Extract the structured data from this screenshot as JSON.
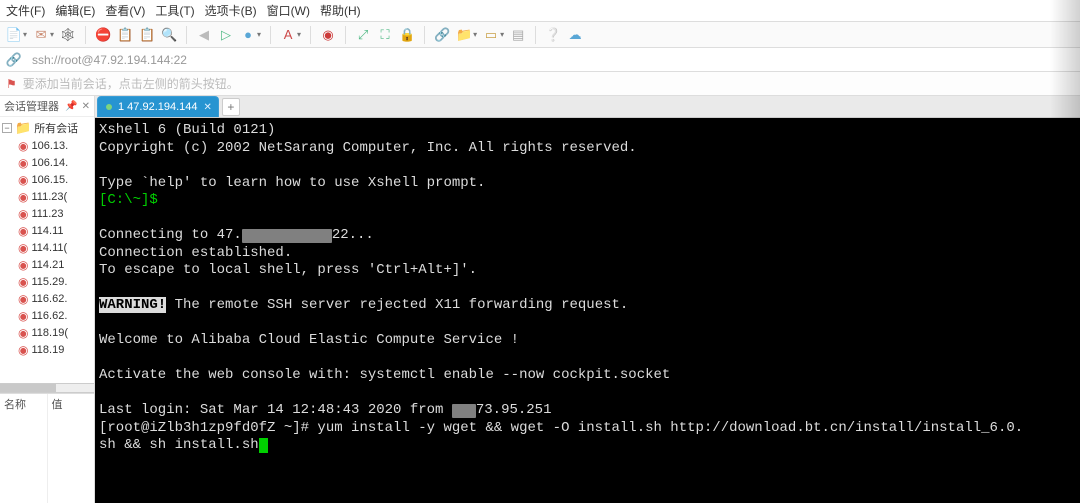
{
  "menu": {
    "items": [
      "文件(F)",
      "编辑(E)",
      "查看(V)",
      "工具(T)",
      "选项卡(B)",
      "窗口(W)",
      "帮助(H)"
    ]
  },
  "toolbar": {
    "icons": [
      {
        "name": "new-session-icon",
        "glyph": "📄",
        "drop": true,
        "clr": "#3a77c2"
      },
      {
        "name": "open-icon",
        "glyph": "✉",
        "drop": true,
        "clr": "#c9886e"
      },
      {
        "name": "reconnect-icon",
        "glyph": "🕸",
        "clr": "#555"
      },
      {
        "name": "disconnect-icon",
        "glyph": "⛔",
        "clr": "#aaa",
        "sep_before": true
      },
      {
        "name": "copy-icon",
        "glyph": "📋",
        "clr": "#3a77c2"
      },
      {
        "name": "paste-icon",
        "glyph": "📋",
        "clr": "#aaa"
      },
      {
        "name": "find-icon",
        "glyph": "🔍",
        "clr": "#555"
      },
      {
        "name": "nav-back-icon",
        "glyph": "◀",
        "clr": "#bbb",
        "sep_before": true
      },
      {
        "name": "nav-fwd-icon",
        "glyph": "▷",
        "clr": "#5b8"
      },
      {
        "name": "dot-icon",
        "glyph": "●",
        "drop": true,
        "clr": "#5aa7d6"
      },
      {
        "name": "font-icon",
        "glyph": "A",
        "drop": true,
        "clr": "#cc4848",
        "sep_before": true
      },
      {
        "name": "record-icon",
        "glyph": "◉",
        "clr": "#cc3a3a",
        "sep_before": true
      },
      {
        "name": "exit-full-icon",
        "glyph": "⤢",
        "clr": "#5b8",
        "sep_before": true
      },
      {
        "name": "fullscreen-icon",
        "glyph": "⛶",
        "clr": "#5b8"
      },
      {
        "name": "lock-icon",
        "glyph": "🔒",
        "clr": "#c9a24a"
      },
      {
        "name": "tunnel-icon",
        "glyph": "🔗",
        "clr": "#aaa",
        "sep_before": true
      },
      {
        "name": "xftp-icon",
        "glyph": "📁",
        "drop": true,
        "clr": "#4fa5d8"
      },
      {
        "name": "tile-icon",
        "glyph": "▭",
        "drop": true,
        "clr": "#c9a24a"
      },
      {
        "name": "script-icon",
        "glyph": "▤",
        "clr": "#aaa"
      },
      {
        "name": "about-icon",
        "glyph": "❔",
        "clr": "#5aa7d6",
        "sep_before": true
      },
      {
        "name": "cloud-icon",
        "glyph": "☁",
        "clr": "#5aa7d6"
      }
    ]
  },
  "addrbar": {
    "icon_name": "link-icon",
    "text": "ssh://root@47.92.194.144:22"
  },
  "tipbar": {
    "icon_name": "flag-icon",
    "text": "要添加当前会话，点击左侧的箭头按钮。"
  },
  "sidebar": {
    "title": "会话管理器",
    "root": "所有会话",
    "items": [
      "106.13.",
      "106.14.",
      "106.15.",
      "111.23(",
      "111.23",
      "114.11",
      "114.11(",
      "114.21",
      "115.29.",
      "116.62.",
      "116.62.",
      "118.19(",
      "118.19"
    ],
    "props": {
      "col1": "名称",
      "col2": "值"
    }
  },
  "tabs": {
    "active": {
      "label": "1 47.92.194.144",
      "has_close": true
    }
  },
  "terminal": {
    "lines": [
      {
        "t": "plain",
        "v": "Xshell 6 (Build 0121)"
      },
      {
        "t": "plain",
        "v": "Copyright (c) 2002 NetSarang Computer, Inc. All rights reserved."
      },
      {
        "t": "blank"
      },
      {
        "t": "plain",
        "v": "Type `help' to learn how to use Xshell prompt."
      },
      {
        "t": "prompt",
        "v": "[C:\\~]$"
      },
      {
        "t": "blank"
      },
      {
        "t": "connecting",
        "pre": "Connecting to 47.",
        "mid_redact": 90,
        "post": "22..."
      },
      {
        "t": "plain",
        "v": "Connection established."
      },
      {
        "t": "plain",
        "v": "To escape to local shell, press 'Ctrl+Alt+]'."
      },
      {
        "t": "blank"
      },
      {
        "t": "warn",
        "label": "WARNING!",
        "rest": " The remote SSH server rejected X11 forwarding request."
      },
      {
        "t": "blank"
      },
      {
        "t": "plain",
        "v": "Welcome to Alibaba Cloud Elastic Compute Service !"
      },
      {
        "t": "blank"
      },
      {
        "t": "plain",
        "v": "Activate the web console with: systemctl enable --now cockpit.socket"
      },
      {
        "t": "blank"
      },
      {
        "t": "lastlogin",
        "pre": "Last login: Sat Mar 14 12:48:43 2020 from ",
        "redact": 24,
        "post": "73.95.251"
      },
      {
        "t": "plain",
        "v": "[root@iZlb3h1zp9fd0fZ ~]# yum install -y wget && wget -O install.sh http://download.bt.cn/install/install_6.0."
      },
      {
        "t": "cmd_cont",
        "v": "sh && sh install.sh"
      }
    ]
  }
}
